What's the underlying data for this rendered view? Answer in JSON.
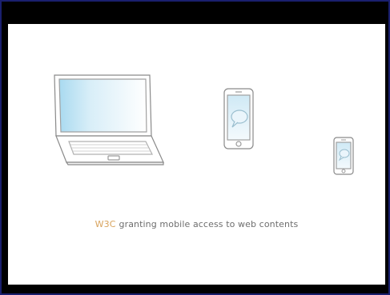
{
  "caption": {
    "brand": "W3C",
    "text": "granting mobile access to web contents"
  },
  "colors": {
    "brand": "#d8a35c",
    "caption_text": "#6e6e6e",
    "screen_glow": "#bde3f3",
    "device_outline": "#8a8a8a",
    "letterbox": "#000000",
    "frame_border": "#1a1f6e"
  },
  "illustration": {
    "devices": [
      "laptop",
      "tablet",
      "smartphone"
    ],
    "screen_icon": "speech-bubble-icon"
  }
}
